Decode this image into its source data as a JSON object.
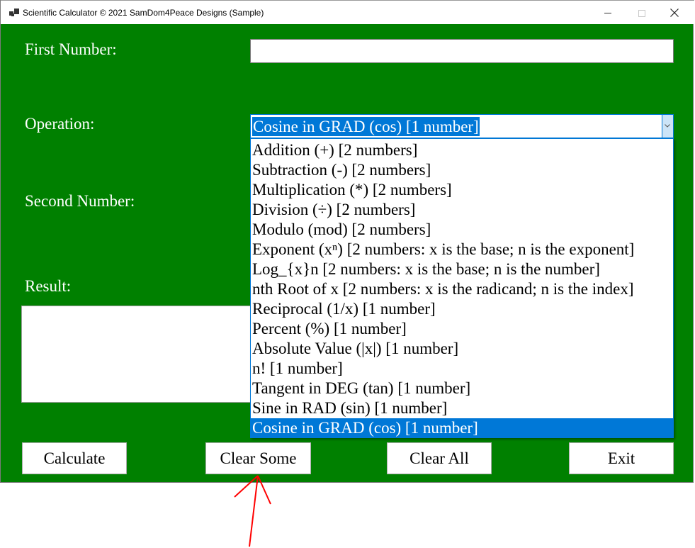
{
  "window": {
    "title": "Scientific Calculator © 2021 SamDom4Peace Designs (Sample)",
    "icon": "app-window-icon",
    "controls": [
      "minimize",
      "maximize",
      "close"
    ]
  },
  "form": {
    "first_number_label": "First Number:",
    "first_number_value": "",
    "operation_label": "Operation:",
    "operation_selected": "Cosine in GRAD (cos) [1 number]",
    "second_number_label": "Second Number:",
    "result_label": "Result:",
    "result_value": ""
  },
  "operations": [
    {
      "label": "Addition (+) [2 numbers]",
      "selected": false
    },
    {
      "label": "Subtraction (-) [2 numbers]",
      "selected": false
    },
    {
      "label": "Multiplication (*) [2 numbers]",
      "selected": false
    },
    {
      "label": "Division (÷) [2 numbers]",
      "selected": false
    },
    {
      "label": "Modulo (mod) [2 numbers]",
      "selected": false
    },
    {
      "label": "Exponent (xⁿ) [2 numbers: x is the base; n is the exponent]",
      "selected": false
    },
    {
      "label": "Log_{x}n [2 numbers: x is the base; n is the number]",
      "selected": false
    },
    {
      "label": "nth Root of x [2 numbers: x is the radicand; n is the index]",
      "selected": false
    },
    {
      "label": "Reciprocal (1/x) [1 number]",
      "selected": false
    },
    {
      "label": "Percent (%) [1 number]",
      "selected": false
    },
    {
      "label": "Absolute Value (|x|) [1 number]",
      "selected": false
    },
    {
      "label": "n! [1 number]",
      "selected": false
    },
    {
      "label": "Tangent in DEG (tan) [1 number]",
      "selected": false
    },
    {
      "label": "Sine in RAD (sin) [1 number]",
      "selected": false
    },
    {
      "label": "Cosine in GRAD (cos) [1 number]",
      "selected": true
    }
  ],
  "buttons": {
    "calculate": "Calculate",
    "clear_some": "Clear Some",
    "clear_all": "Clear All",
    "exit": "Exit"
  },
  "annotation": {
    "type": "red-arrow",
    "target": "clear-some-button",
    "color": "#ff0000"
  },
  "colors": {
    "background": "#008000",
    "selection": "#0078d7",
    "label_text": "#ffffff"
  }
}
